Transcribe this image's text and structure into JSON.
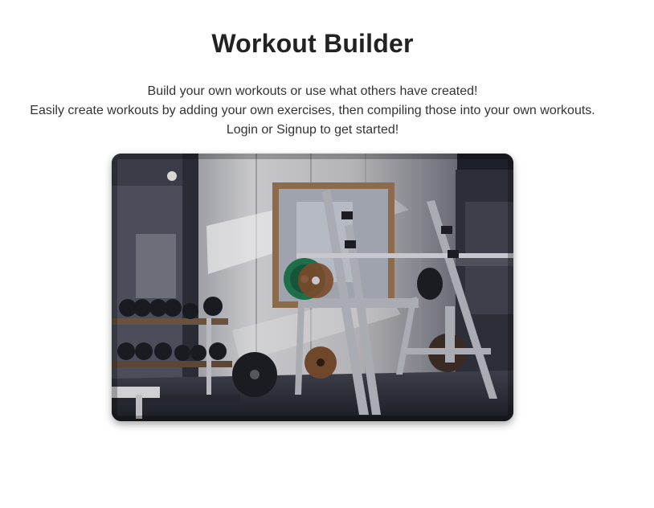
{
  "header": {
    "title": "Workout Builder"
  },
  "intro": {
    "line1": "Build your own workouts or use what others have created!",
    "line2": "Easily create workouts by adding your own exercises, then compiling those into your own workouts.",
    "line3": "Login or Signup to get started!"
  },
  "hero": {
    "image_subject": "gym interior with squat rack, barbell and dumbbell rack"
  },
  "colors": {
    "text": "#222222",
    "background": "#ffffff",
    "plate_green": "#1f6e4a",
    "plate_bronze": "#7a4a2a"
  }
}
